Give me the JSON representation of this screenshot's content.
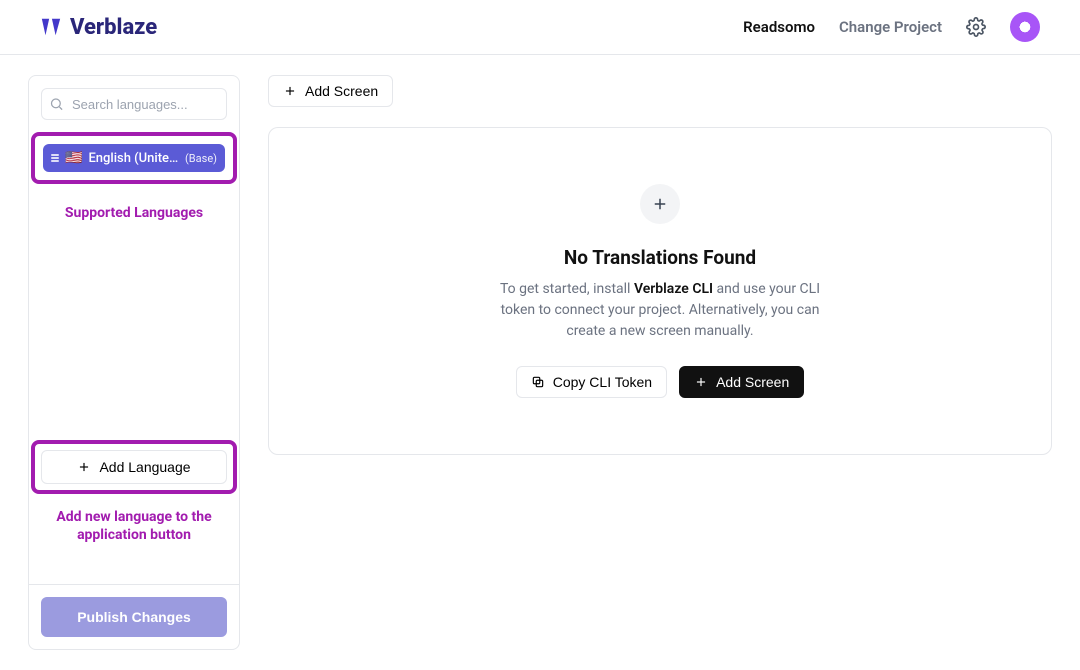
{
  "header": {
    "brand": "Verblaze",
    "project_name": "Readsomo",
    "change_project": "Change Project"
  },
  "sidebar": {
    "search_placeholder": "Search languages...",
    "selected_language": {
      "flag": "🇺🇸",
      "name": "English (Unite…",
      "base_label": "(Base)"
    },
    "annotation_supported": "Supported Languages",
    "add_language_label": "Add Language",
    "annotation_add": "Add new language to the application button",
    "publish_label": "Publish Changes"
  },
  "main": {
    "add_screen_label": "Add Screen",
    "empty": {
      "title": "No Translations Found",
      "desc_pre": "To get started, install ",
      "desc_bold": "Verblaze CLI",
      "desc_post": " and use your CLI token to connect your project. Alternatively, you can create a new screen manually.",
      "copy_token_label": "Copy CLI Token",
      "add_screen_label": "Add Screen"
    }
  }
}
